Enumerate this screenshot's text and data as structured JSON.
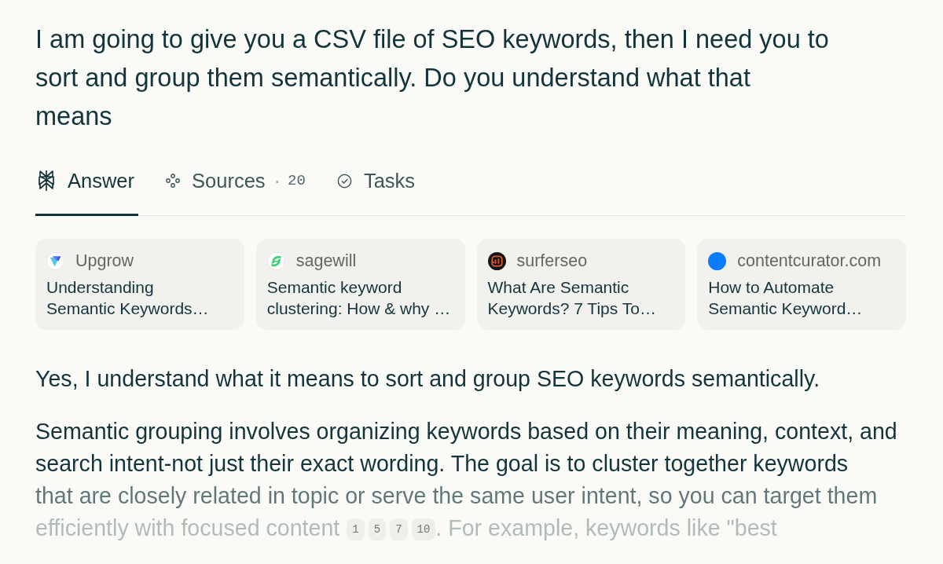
{
  "query": "I am going to give you a CSV file of SEO keywords, then I need you to\nsort and group them semantically. Do you understand what that\nmeans",
  "tabs": [
    {
      "kind": "answer",
      "label": "Answer",
      "selected": true
    },
    {
      "kind": "sources",
      "label": "Sources",
      "separator": "·",
      "count": "20",
      "selected": false
    },
    {
      "kind": "tasks",
      "label": "Tasks",
      "selected": false
    }
  ],
  "sources": [
    {
      "site": "Upgrow",
      "title": "Understanding\nSemantic Keywords…"
    },
    {
      "site": "sagewill",
      "title": "Semantic keyword\nclustering: How & why …"
    },
    {
      "site": "surferseo",
      "title": "What Are Semantic\nKeywords? 7 Tips To…"
    },
    {
      "site": "contentcurator.com",
      "title": "How to Automate\nSemantic Keyword…"
    }
  ],
  "answer": {
    "paragraphs": [
      {
        "runs": [
          {
            "kind": "text",
            "text": "Yes, I understand what it means to sort and group SEO keywords semantically."
          }
        ]
      },
      {
        "runs": [
          {
            "kind": "text",
            "text": "Semantic grouping involves organizing keywords based on their meaning, context, and\nsearch intent-not just their exact wording. The goal is to cluster together keywords\nthat are closely related in topic or serve the same user intent, so you can target them\nefficiently with focused content"
          },
          {
            "kind": "citation",
            "text": "1"
          },
          {
            "kind": "citation",
            "text": "5"
          },
          {
            "kind": "citation",
            "text": "7"
          },
          {
            "kind": "citation",
            "text": "10"
          },
          {
            "kind": "text",
            "text": ". For example, keywords like \"best"
          }
        ]
      }
    ]
  }
}
